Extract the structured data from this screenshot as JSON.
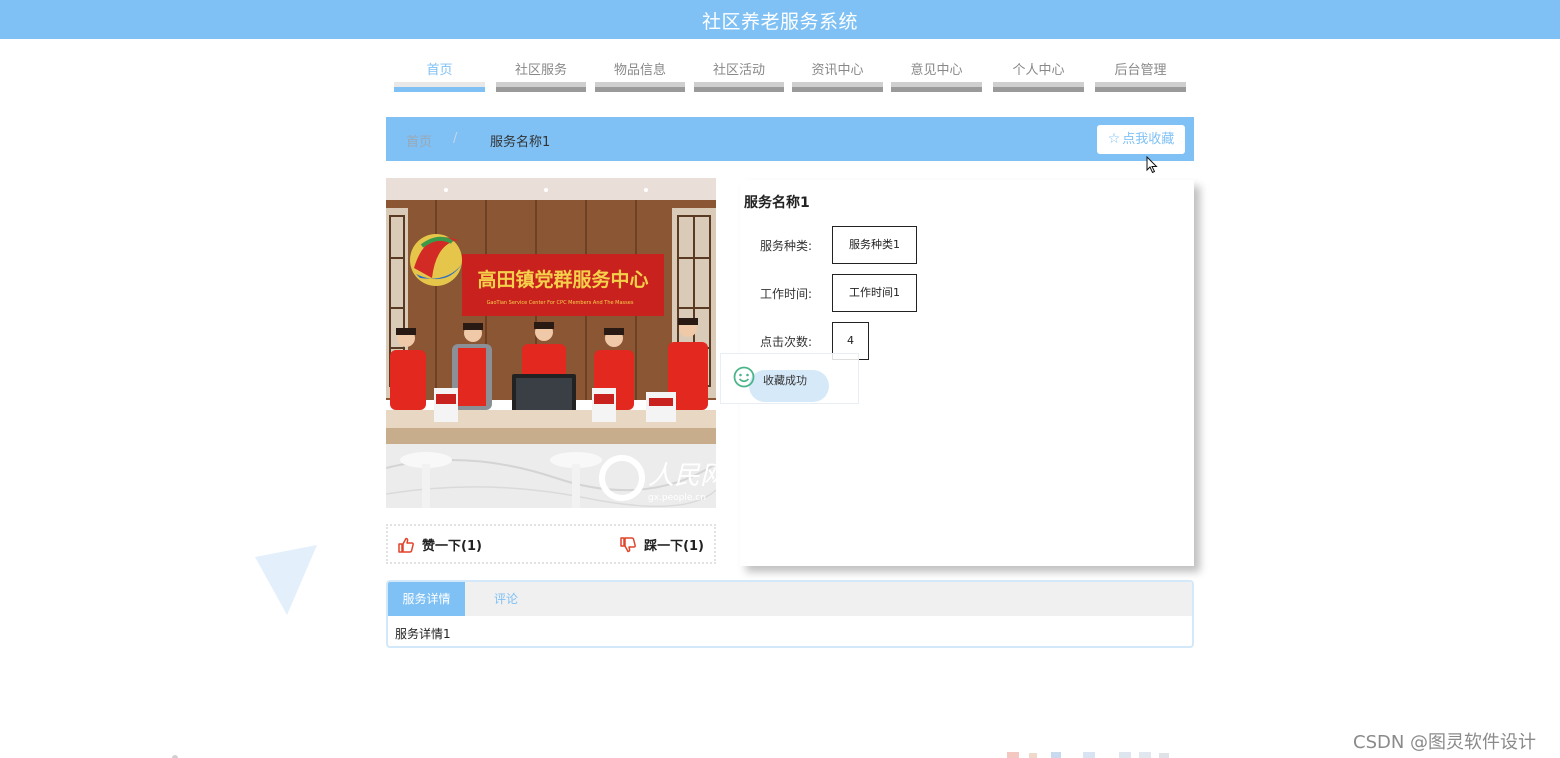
{
  "header": {
    "title": "社区养老服务系统"
  },
  "nav": {
    "items": [
      {
        "label": "首页",
        "active": true
      },
      {
        "label": "社区服务"
      },
      {
        "label": "物品信息"
      },
      {
        "label": "社区活动"
      },
      {
        "label": "资讯中心"
      },
      {
        "label": "意见中心"
      },
      {
        "label": "个人中心"
      },
      {
        "label": "后台管理"
      }
    ]
  },
  "breadcrumb": {
    "home": "首页",
    "separator": "/",
    "current": "服务名称1"
  },
  "favorite_button": {
    "label": "点我收藏",
    "icon": "star-outline-icon"
  },
  "detail": {
    "name": "服务名称1",
    "fields": [
      {
        "key": "服务种类:",
        "value": "服务种类1"
      },
      {
        "key": "工作时间:",
        "value": "工作时间1"
      },
      {
        "key": "点击次数:",
        "value": "4"
      }
    ]
  },
  "votes": {
    "up_label": "赞一下(1)",
    "down_label": "踩一下(1)",
    "up_icon": "thumbs-up-icon",
    "down_icon": "thumbs-down-icon"
  },
  "toast": {
    "message": "收藏成功",
    "icon": "smile-icon"
  },
  "photo": {
    "sign_text": "高田镇党群服务中心",
    "sign_subtext": "GaoTian Service Center For CPC Members And The Masses",
    "logo_text": "人民网",
    "logo_url_text": "gx.people.cn"
  },
  "tabs": {
    "items": [
      {
        "label": "服务详情",
        "active": true
      },
      {
        "label": "评论"
      }
    ],
    "content": "服务详情1"
  },
  "watermark": "CSDN @图灵软件设计",
  "colors": {
    "accent": "#7fc1f5",
    "nav_bar": "#9a9a9a",
    "vote_icon": "#e0442a"
  }
}
